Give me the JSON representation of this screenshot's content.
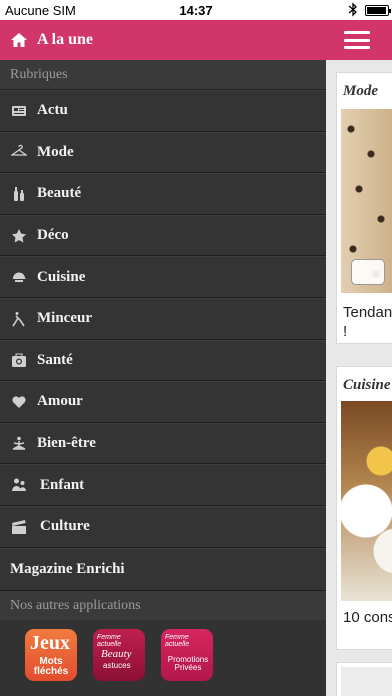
{
  "status_bar": {
    "carrier": "Aucune SIM",
    "time": "14:37"
  },
  "menu": {
    "header_title": "A la une",
    "section_label": "Rubriques",
    "items": [
      {
        "label": "Actu",
        "icon": "newspaper-icon"
      },
      {
        "label": "Mode",
        "icon": "hanger-icon"
      },
      {
        "label": "Beauté",
        "icon": "cosmetics-icon"
      },
      {
        "label": "Déco",
        "icon": "star-icon"
      },
      {
        "label": "Cuisine",
        "icon": "chef-hat-icon"
      },
      {
        "label": "Minceur",
        "icon": "runner-icon"
      },
      {
        "label": "Santé",
        "icon": "medical-kit-icon"
      },
      {
        "label": "Amour",
        "icon": "heart-icon"
      },
      {
        "label": "Bien-être",
        "icon": "meditation-icon"
      },
      {
        "label": "Enfant",
        "icon": "family-icon"
      },
      {
        "label": "Culture",
        "icon": "clapperboard-icon"
      }
    ],
    "magazine_label": "Magazine Enrichi",
    "apps_label": "Nos autres applications",
    "apps": [
      {
        "name": "Jeux",
        "sub": "Mots fléchés"
      },
      {
        "brand": "Femme actuelle",
        "name": "Beauty",
        "sub": "astuces"
      },
      {
        "brand": "Femme actuelle",
        "name": "Promotions Privées"
      }
    ]
  },
  "colors": {
    "accent": "#d2356a",
    "menu_bg": "#323232",
    "section_bg": "#3a3a3a",
    "text_light": "#f2f2f2",
    "muted": "#9b9b9b"
  },
  "feed": {
    "cards": [
      {
        "tag": "Mode",
        "caption_line1": "Tendan",
        "caption_line2": "!"
      },
      {
        "tag": "Cuisine",
        "caption_line1": "10 cons"
      },
      {}
    ]
  }
}
